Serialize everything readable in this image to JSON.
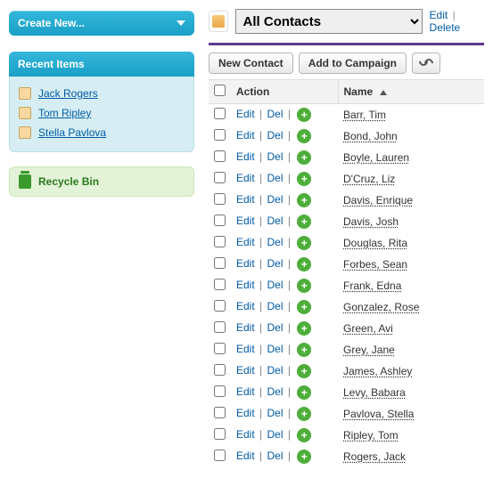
{
  "sidebar": {
    "create_new_label": "Create New...",
    "recent_items_header": "Recent Items",
    "recent_items": [
      {
        "label": "Jack Rogers"
      },
      {
        "label": "Tom Ripley"
      },
      {
        "label": "Stella Pavlova"
      }
    ],
    "recycle_bin_label": "Recycle Bin"
  },
  "view": {
    "selected": "All Contacts",
    "edit_label": "Edit",
    "delete_label": "Delete"
  },
  "toolbar": {
    "new_contact_label": "New Contact",
    "add_to_campaign_label": "Add to Campaign"
  },
  "table": {
    "action_header": "Action",
    "name_header": "Name",
    "edit_label": "Edit",
    "del_label": "Del",
    "rows": [
      {
        "name": "Barr, Tim"
      },
      {
        "name": "Bond, John"
      },
      {
        "name": "Boyle, Lauren"
      },
      {
        "name": "D'Cruz, Liz"
      },
      {
        "name": "Davis, Enrique"
      },
      {
        "name": "Davis, Josh"
      },
      {
        "name": "Douglas, Rita"
      },
      {
        "name": "Forbes, Sean"
      },
      {
        "name": "Frank, Edna"
      },
      {
        "name": "Gonzalez, Rose"
      },
      {
        "name": "Green, Avi"
      },
      {
        "name": "Grey, Jane"
      },
      {
        "name": "James, Ashley"
      },
      {
        "name": "Levy, Babara"
      },
      {
        "name": "Pavlova, Stella"
      },
      {
        "name": "Ripley, Tom"
      },
      {
        "name": "Rogers, Jack"
      }
    ]
  }
}
